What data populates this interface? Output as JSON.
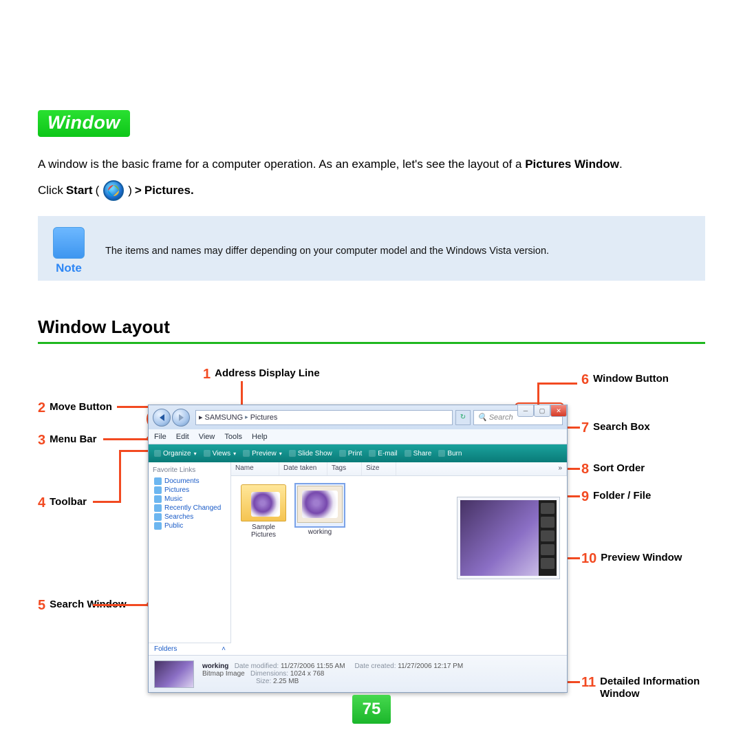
{
  "chip": "Window",
  "intro_pre": "A window is the basic frame for a computer operation. As an example, let's see the layout of a ",
  "intro_bold": "Pictures Window",
  "intro_post": ".",
  "click": {
    "pre": "Click ",
    "b1": "Start",
    "paren_open": "(",
    "paren_close": ")",
    "gt": " > ",
    "b2": "Pictures."
  },
  "note": {
    "label": "Note",
    "text": "The items and names may differ depending on your computer model and the Windows Vista version."
  },
  "section": "Window Layout",
  "callouts": {
    "c1": {
      "n": "1",
      "t": "Address Display Line"
    },
    "c2": {
      "n": "2",
      "t": "Move Button"
    },
    "c3": {
      "n": "3",
      "t": "Menu Bar"
    },
    "c4": {
      "n": "4",
      "t": "Toolbar"
    },
    "c5": {
      "n": "5",
      "t": "Search Window"
    },
    "c6": {
      "n": "6",
      "t": "Window Button"
    },
    "c7": {
      "n": "7",
      "t": "Search Box"
    },
    "c8": {
      "n": "8",
      "t": "Sort Order"
    },
    "c9": {
      "n": "9",
      "t": "Folder / File"
    },
    "c10": {
      "n": "10",
      "t": "Preview Window"
    },
    "c11": {
      "n": "11",
      "t": "Detailed Information Window"
    }
  },
  "explorer": {
    "path": [
      "SAMSUNG",
      "Pictures"
    ],
    "search_placeholder": "Search",
    "menu": [
      "File",
      "Edit",
      "View",
      "Tools",
      "Help"
    ],
    "toolbar": [
      "Organize",
      "Views",
      "Preview",
      "Slide Show",
      "Print",
      "E-mail",
      "Share",
      "Burn"
    ],
    "sidebar_header": "Favorite Links",
    "sidebar": [
      "Documents",
      "Pictures",
      "Music",
      "Recently Changed",
      "Searches",
      "Public"
    ],
    "folders": "Folders",
    "cols": [
      "Name",
      "Date taken",
      "Tags",
      "Size",
      "»"
    ],
    "thumbs": {
      "a": "Sample Pictures",
      "b": "working"
    },
    "details": {
      "name": "working",
      "type": "Bitmap Image",
      "dm_lbl": "Date modified:",
      "dm": "11/27/2006 11:55 AM",
      "dim_lbl": "Dimensions:",
      "dim": "1024 x 768",
      "sz_lbl": "Size:",
      "sz": "2.25 MB",
      "dc_lbl": "Date created:",
      "dc": "11/27/2006 12:17 PM"
    }
  },
  "page_number": "75"
}
